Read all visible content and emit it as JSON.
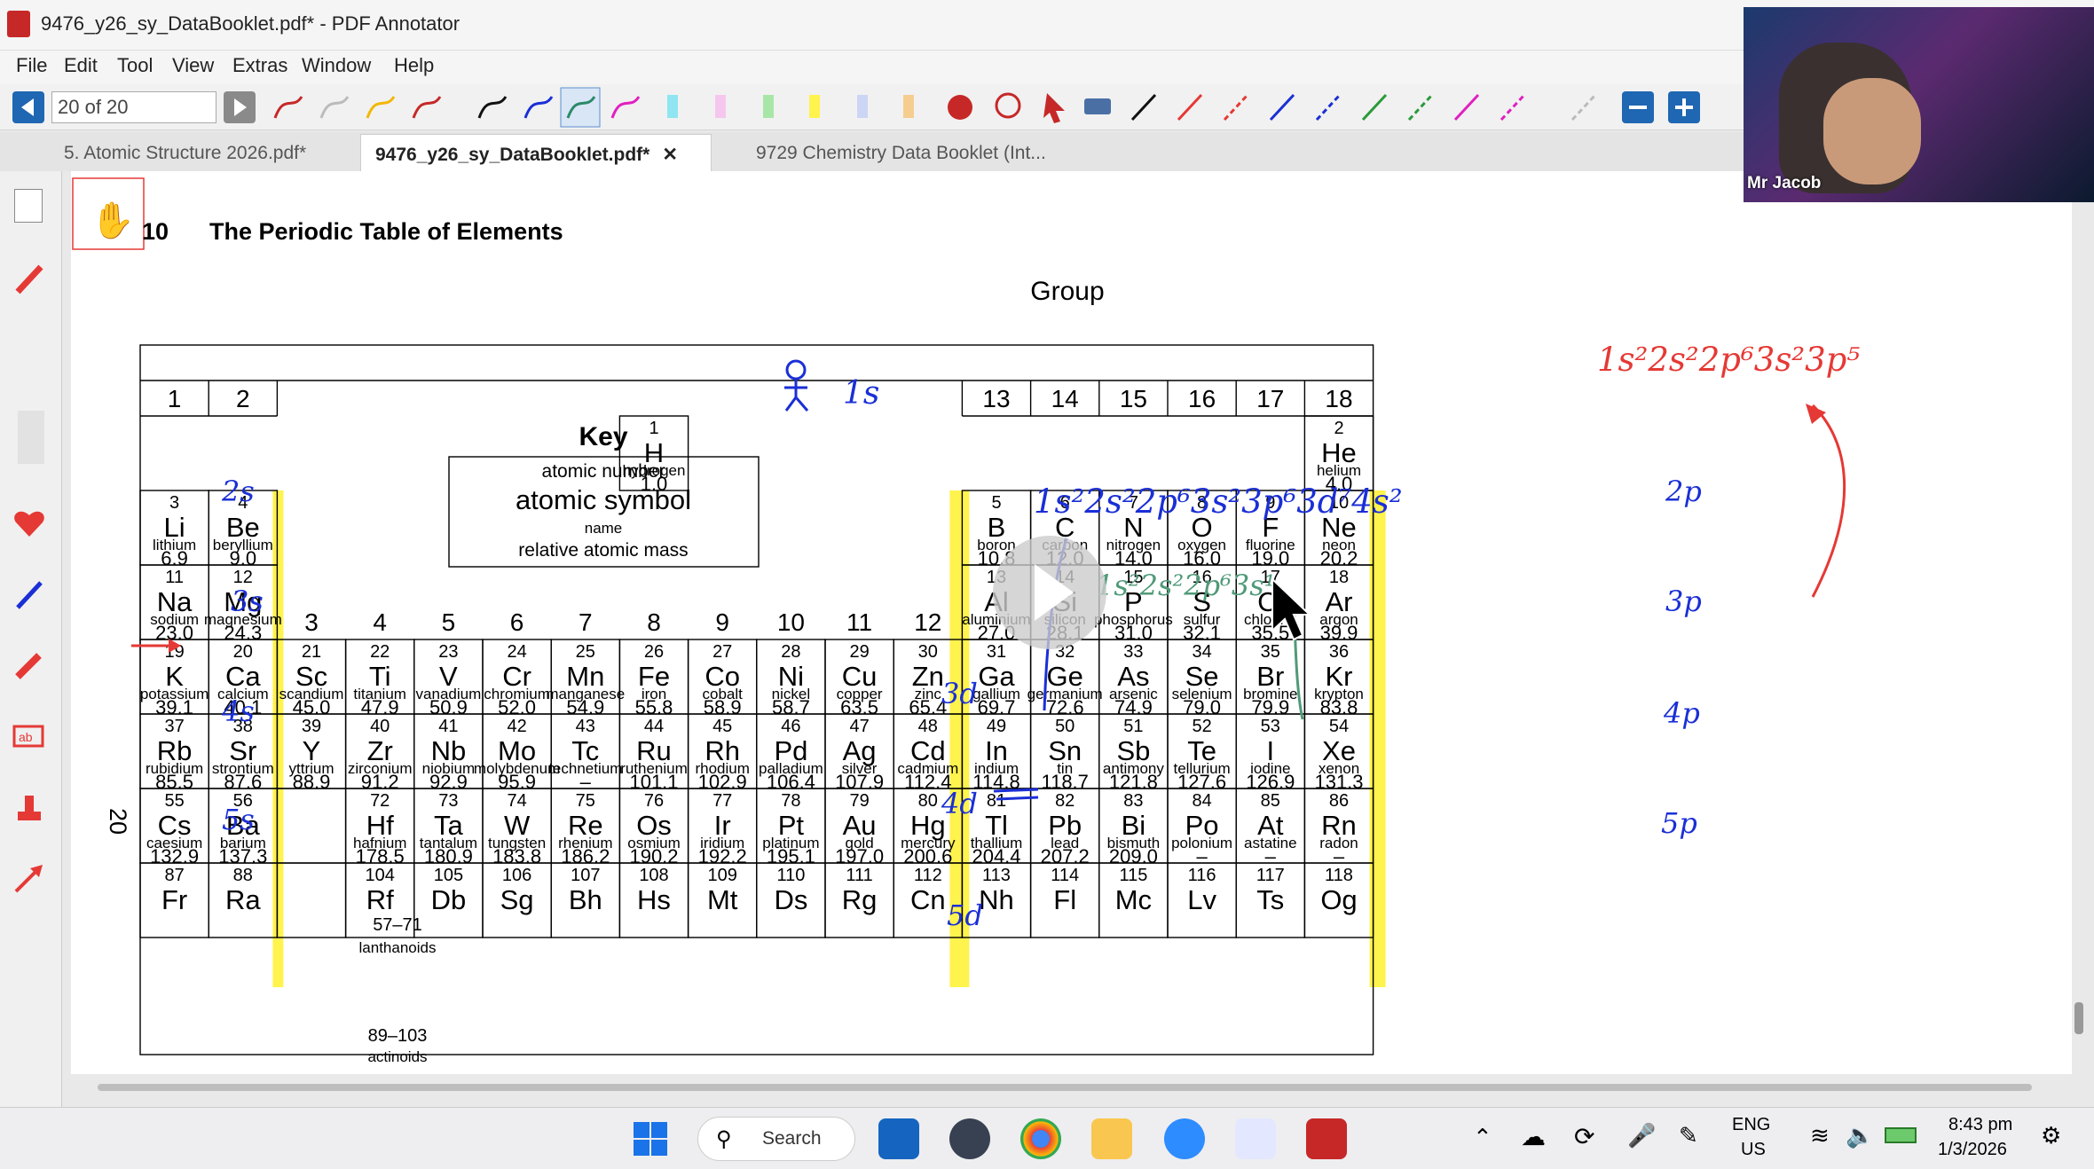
{
  "window": {
    "title": "9476_y26_sy_DataBooklet.pdf* - PDF Annotator"
  },
  "menu": [
    "File",
    "Edit",
    "Tool",
    "View",
    "Extras",
    "Window",
    "Help"
  ],
  "toolbar": {
    "page_value": "20 of 20"
  },
  "tabs": [
    {
      "label": "5. Atomic Structure 2026.pdf*"
    },
    {
      "label": "9476_y26_sy_DataBooklet.pdf*"
    },
    {
      "label": "9729 Chemistry Data Booklet (Int..."
    }
  ],
  "webcam": {
    "name": "Mr Jacob"
  },
  "doc": {
    "section_number": "10",
    "section_title": "The Periodic Table of Elements",
    "group_label": "Group",
    "groups_left": [
      "1",
      "2"
    ],
    "groups_right": [
      "13",
      "14",
      "15",
      "16",
      "17",
      "18"
    ],
    "groups_mid": [
      "3",
      "4",
      "5",
      "6",
      "7",
      "8",
      "9",
      "10",
      "11",
      "12"
    ],
    "key": {
      "title": "Key",
      "l1": "atomic number",
      "l2": "atomic symbol",
      "l3": "name",
      "l4": "relative atomic mass"
    },
    "page_number": "20",
    "lanthanoids": {
      "num": "57–71",
      "name": "lanthanoids"
    },
    "actinoids": {
      "num": "89–103",
      "name": "actinoids"
    },
    "elements": [
      {
        "n": "1",
        "s": "H",
        "name": "hydrogen",
        "m": "1.0",
        "c": 8,
        "r": 0
      },
      {
        "n": "2",
        "s": "He",
        "name": "helium",
        "m": "4.0",
        "c": 18,
        "r": 0
      },
      {
        "n": "3",
        "s": "Li",
        "name": "lithium",
        "m": "6.9",
        "c": 1,
        "r": 1
      },
      {
        "n": "4",
        "s": "Be",
        "name": "beryllium",
        "m": "9.0",
        "c": 2,
        "r": 1
      },
      {
        "n": "5",
        "s": "B",
        "name": "boron",
        "m": "10.8",
        "c": 13,
        "r": 1
      },
      {
        "n": "6",
        "s": "C",
        "name": "carbon",
        "m": "12.0",
        "c": 14,
        "r": 1
      },
      {
        "n": "7",
        "s": "N",
        "name": "nitrogen",
        "m": "14.0",
        "c": 15,
        "r": 1
      },
      {
        "n": "8",
        "s": "O",
        "name": "oxygen",
        "m": "16.0",
        "c": 16,
        "r": 1
      },
      {
        "n": "9",
        "s": "F",
        "name": "fluorine",
        "m": "19.0",
        "c": 17,
        "r": 1
      },
      {
        "n": "10",
        "s": "Ne",
        "name": "neon",
        "m": "20.2",
        "c": 18,
        "r": 1
      },
      {
        "n": "11",
        "s": "Na",
        "name": "sodium",
        "m": "23.0",
        "c": 1,
        "r": 2
      },
      {
        "n": "12",
        "s": "Mg",
        "name": "magnesium",
        "m": "24.3",
        "c": 2,
        "r": 2
      },
      {
        "n": "13",
        "s": "Al",
        "name": "aluminium",
        "m": "27.0",
        "c": 13,
        "r": 2
      },
      {
        "n": "14",
        "s": "Si",
        "name": "silicon",
        "m": "28.1",
        "c": 14,
        "r": 2
      },
      {
        "n": "15",
        "s": "P",
        "name": "phosphorus",
        "m": "31.0",
        "c": 15,
        "r": 2
      },
      {
        "n": "16",
        "s": "S",
        "name": "sulfur",
        "m": "32.1",
        "c": 16,
        "r": 2
      },
      {
        "n": "17",
        "s": "Cl",
        "name": "chlorine",
        "m": "35.5",
        "c": 17,
        "r": 2
      },
      {
        "n": "18",
        "s": "Ar",
        "name": "argon",
        "m": "39.9",
        "c": 18,
        "r": 2
      },
      {
        "n": "19",
        "s": "K",
        "name": "potassium",
        "m": "39.1",
        "c": 1,
        "r": 3
      },
      {
        "n": "20",
        "s": "Ca",
        "name": "calcium",
        "m": "40.1",
        "c": 2,
        "r": 3
      },
      {
        "n": "21",
        "s": "Sc",
        "name": "scandium",
        "m": "45.0",
        "c": 3,
        "r": 3
      },
      {
        "n": "22",
        "s": "Ti",
        "name": "titanium",
        "m": "47.9",
        "c": 4,
        "r": 3
      },
      {
        "n": "23",
        "s": "V",
        "name": "vanadium",
        "m": "50.9",
        "c": 5,
        "r": 3
      },
      {
        "n": "24",
        "s": "Cr",
        "name": "chromium",
        "m": "52.0",
        "c": 6,
        "r": 3
      },
      {
        "n": "25",
        "s": "Mn",
        "name": "manganese",
        "m": "54.9",
        "c": 7,
        "r": 3
      },
      {
        "n": "26",
        "s": "Fe",
        "name": "iron",
        "m": "55.8",
        "c": 8,
        "r": 3
      },
      {
        "n": "27",
        "s": "Co",
        "name": "cobalt",
        "m": "58.9",
        "c": 9,
        "r": 3
      },
      {
        "n": "28",
        "s": "Ni",
        "name": "nickel",
        "m": "58.7",
        "c": 10,
        "r": 3
      },
      {
        "n": "29",
        "s": "Cu",
        "name": "copper",
        "m": "63.5",
        "c": 11,
        "r": 3
      },
      {
        "n": "30",
        "s": "Zn",
        "name": "zinc",
        "m": "65.4",
        "c": 12,
        "r": 3
      },
      {
        "n": "31",
        "s": "Ga",
        "name": "gallium",
        "m": "69.7",
        "c": 13,
        "r": 3
      },
      {
        "n": "32",
        "s": "Ge",
        "name": "germanium",
        "m": "72.6",
        "c": 14,
        "r": 3
      },
      {
        "n": "33",
        "s": "As",
        "name": "arsenic",
        "m": "74.9",
        "c": 15,
        "r": 3
      },
      {
        "n": "34",
        "s": "Se",
        "name": "selenium",
        "m": "79.0",
        "c": 16,
        "r": 3
      },
      {
        "n": "35",
        "s": "Br",
        "name": "bromine",
        "m": "79.9",
        "c": 17,
        "r": 3
      },
      {
        "n": "36",
        "s": "Kr",
        "name": "krypton",
        "m": "83.8",
        "c": 18,
        "r": 3
      },
      {
        "n": "37",
        "s": "Rb",
        "name": "rubidium",
        "m": "85.5",
        "c": 1,
        "r": 4
      },
      {
        "n": "38",
        "s": "Sr",
        "name": "strontium",
        "m": "87.6",
        "c": 2,
        "r": 4
      },
      {
        "n": "39",
        "s": "Y",
        "name": "yttrium",
        "m": "88.9",
        "c": 3,
        "r": 4
      },
      {
        "n": "40",
        "s": "Zr",
        "name": "zirconium",
        "m": "91.2",
        "c": 4,
        "r": 4
      },
      {
        "n": "41",
        "s": "Nb",
        "name": "niobium",
        "m": "92.9",
        "c": 5,
        "r": 4
      },
      {
        "n": "42",
        "s": "Mo",
        "name": "molybdenum",
        "m": "95.9",
        "c": 6,
        "r": 4
      },
      {
        "n": "43",
        "s": "Tc",
        "name": "technetium",
        "m": "–",
        "c": 7,
        "r": 4
      },
      {
        "n": "44",
        "s": "Ru",
        "name": "ruthenium",
        "m": "101.1",
        "c": 8,
        "r": 4
      },
      {
        "n": "45",
        "s": "Rh",
        "name": "rhodium",
        "m": "102.9",
        "c": 9,
        "r": 4
      },
      {
        "n": "46",
        "s": "Pd",
        "name": "palladium",
        "m": "106.4",
        "c": 10,
        "r": 4
      },
      {
        "n": "47",
        "s": "Ag",
        "name": "silver",
        "m": "107.9",
        "c": 11,
        "r": 4
      },
      {
        "n": "48",
        "s": "Cd",
        "name": "cadmium",
        "m": "112.4",
        "c": 12,
        "r": 4
      },
      {
        "n": "49",
        "s": "In",
        "name": "indium",
        "m": "114.8",
        "c": 13,
        "r": 4
      },
      {
        "n": "50",
        "s": "Sn",
        "name": "tin",
        "m": "118.7",
        "c": 14,
        "r": 4
      },
      {
        "n": "51",
        "s": "Sb",
        "name": "antimony",
        "m": "121.8",
        "c": 15,
        "r": 4
      },
      {
        "n": "52",
        "s": "Te",
        "name": "tellurium",
        "m": "127.6",
        "c": 16,
        "r": 4
      },
      {
        "n": "53",
        "s": "I",
        "name": "iodine",
        "m": "126.9",
        "c": 17,
        "r": 4
      },
      {
        "n": "54",
        "s": "Xe",
        "name": "xenon",
        "m": "131.3",
        "c": 18,
        "r": 4
      },
      {
        "n": "55",
        "s": "Cs",
        "name": "caesium",
        "m": "132.9",
        "c": 1,
        "r": 5
      },
      {
        "n": "56",
        "s": "Ba",
        "name": "barium",
        "m": "137.3",
        "c": 2,
        "r": 5
      },
      {
        "n": "72",
        "s": "Hf",
        "name": "hafnium",
        "m": "178.5",
        "c": 4,
        "r": 5
      },
      {
        "n": "73",
        "s": "Ta",
        "name": "tantalum",
        "m": "180.9",
        "c": 5,
        "r": 5
      },
      {
        "n": "74",
        "s": "W",
        "name": "tungsten",
        "m": "183.8",
        "c": 6,
        "r": 5
      },
      {
        "n": "75",
        "s": "Re",
        "name": "rhenium",
        "m": "186.2",
        "c": 7,
        "r": 5
      },
      {
        "n": "76",
        "s": "Os",
        "name": "osmium",
        "m": "190.2",
        "c": 8,
        "r": 5
      },
      {
        "n": "77",
        "s": "Ir",
        "name": "iridium",
        "m": "192.2",
        "c": 9,
        "r": 5
      },
      {
        "n": "78",
        "s": "Pt",
        "name": "platinum",
        "m": "195.1",
        "c": 10,
        "r": 5
      },
      {
        "n": "79",
        "s": "Au",
        "name": "gold",
        "m": "197.0",
        "c": 11,
        "r": 5
      },
      {
        "n": "80",
        "s": "Hg",
        "name": "mercury",
        "m": "200.6",
        "c": 12,
        "r": 5
      },
      {
        "n": "81",
        "s": "Tl",
        "name": "thallium",
        "m": "204.4",
        "c": 13,
        "r": 5
      },
      {
        "n": "82",
        "s": "Pb",
        "name": "lead",
        "m": "207.2",
        "c": 14,
        "r": 5
      },
      {
        "n": "83",
        "s": "Bi",
        "name": "bismuth",
        "m": "209.0",
        "c": 15,
        "r": 5
      },
      {
        "n": "84",
        "s": "Po",
        "name": "polonium",
        "m": "–",
        "c": 16,
        "r": 5
      },
      {
        "n": "85",
        "s": "At",
        "name": "astatine",
        "m": "–",
        "c": 17,
        "r": 5
      },
      {
        "n": "86",
        "s": "Rn",
        "name": "radon",
        "m": "–",
        "c": 18,
        "r": 5
      },
      {
        "n": "87",
        "s": "Fr",
        "name": "",
        "m": "",
        "c": 1,
        "r": 6
      },
      {
        "n": "88",
        "s": "Ra",
        "name": "",
        "m": "",
        "c": 2,
        "r": 6
      },
      {
        "n": "104",
        "s": "Rf",
        "name": "",
        "m": "",
        "c": 4,
        "r": 6
      },
      {
        "n": "105",
        "s": "Db",
        "name": "",
        "m": "",
        "c": 5,
        "r": 6
      },
      {
        "n": "106",
        "s": "Sg",
        "name": "",
        "m": "",
        "c": 6,
        "r": 6
      },
      {
        "n": "107",
        "s": "Bh",
        "name": "",
        "m": "",
        "c": 7,
        "r": 6
      },
      {
        "n": "108",
        "s": "Hs",
        "name": "",
        "m": "",
        "c": 8,
        "r": 6
      },
      {
        "n": "109",
        "s": "Mt",
        "name": "",
        "m": "",
        "c": 9,
        "r": 6
      },
      {
        "n": "110",
        "s": "Ds",
        "name": "",
        "m": "",
        "c": 10,
        "r": 6
      },
      {
        "n": "111",
        "s": "Rg",
        "name": "",
        "m": "",
        "c": 11,
        "r": 6
      },
      {
        "n": "112",
        "s": "Cn",
        "name": "",
        "m": "",
        "c": 12,
        "r": 6
      },
      {
        "n": "113",
        "s": "Nh",
        "name": "",
        "m": "",
        "c": 13,
        "r": 6
      },
      {
        "n": "114",
        "s": "Fl",
        "name": "",
        "m": "",
        "c": 14,
        "r": 6
      },
      {
        "n": "115",
        "s": "Mc",
        "name": "",
        "m": "",
        "c": 15,
        "r": 6
      },
      {
        "n": "116",
        "s": "Lv",
        "name": "",
        "m": "",
        "c": 16,
        "r": 6
      },
      {
        "n": "117",
        "s": "Ts",
        "name": "",
        "m": "",
        "c": 17,
        "r": 6
      },
      {
        "n": "118",
        "s": "Og",
        "name": "",
        "m": "",
        "c": 18,
        "r": 6
      }
    ]
  },
  "annotations": {
    "config_ar": "1s²2s²2p⁶3s²3p⁵",
    "config_big": "1s²2s²2p⁶3s²3p⁶3d⁷4s²",
    "config_green": "1s²2s²2p⁶3s¹",
    "labels": [
      "1s",
      "2s",
      "3s",
      "4s",
      "5s",
      "2p",
      "3p",
      "4p",
      "5p",
      "3d",
      "4d",
      "5d"
    ]
  },
  "taskbar": {
    "search": "Search",
    "lang1": "ENG",
    "lang2": "US",
    "time": "8:43 pm",
    "date": "1/3/2026"
  },
  "colors": {
    "ink_blue": "#1a2fd6",
    "ink_red": "#e53935",
    "ink_green": "#4f9a78",
    "highlight": "#fff34d",
    "accent": "#1f66b3"
  }
}
